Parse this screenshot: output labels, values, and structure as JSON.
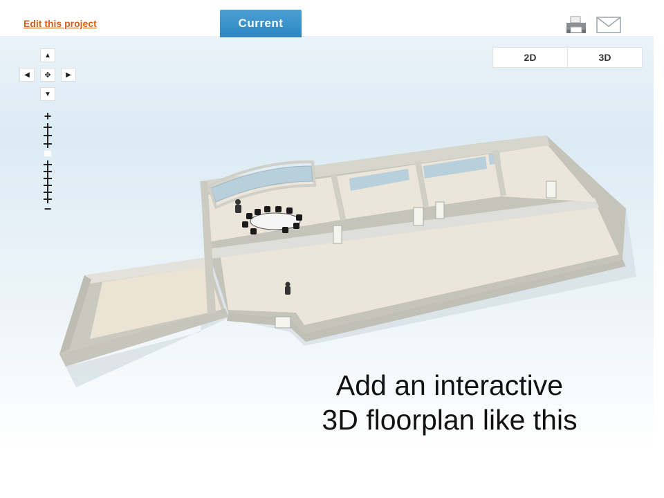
{
  "toolbar": {
    "edit_link": "Edit this project",
    "current_tab": "Current",
    "print_icon": "printer-icon",
    "email_icon": "envelope-icon"
  },
  "view_toggle": {
    "options": [
      "2D",
      "3D"
    ]
  },
  "navigation": {
    "pan_up": "up-arrow-icon",
    "pan_down": "down-arrow-icon",
    "pan_left": "left-arrow-icon",
    "pan_right": "right-arrow-icon",
    "center": "move-center-icon",
    "zoom_in": "+",
    "zoom_out": "−"
  },
  "caption": {
    "line1": "Add an interactive",
    "line2": "3D floorplan like this"
  },
  "colors": {
    "accent": "#2f86c2",
    "link": "#d4601a",
    "wall": "#d8d8d0",
    "floor": "#ede7dc"
  }
}
